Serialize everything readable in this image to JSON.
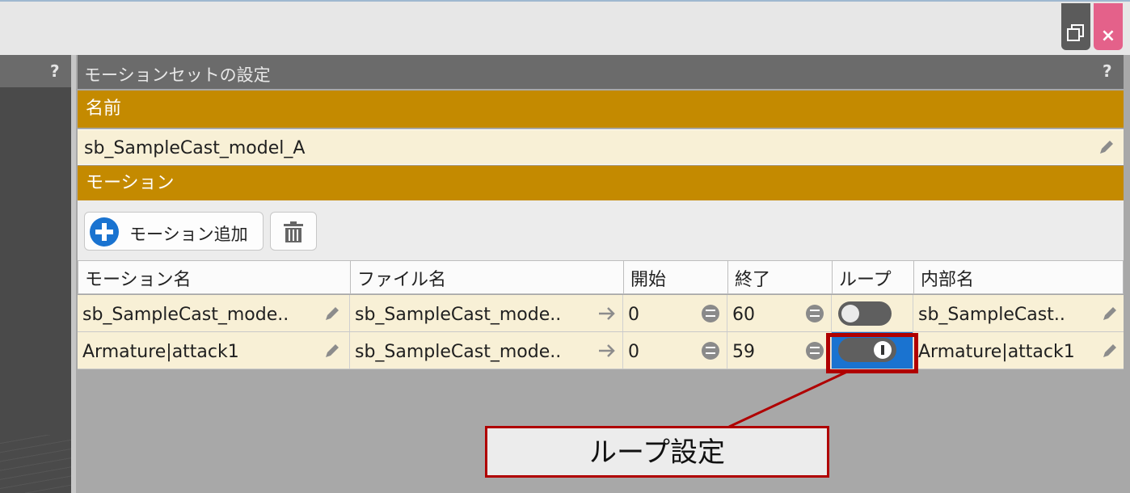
{
  "window": {
    "restore_icon": "restore-window-icon",
    "close_label": "×"
  },
  "left_panel": {
    "help_label": "?"
  },
  "panel": {
    "title": "モーションセットの設定",
    "help_label": "?"
  },
  "name_section": {
    "label": "名前",
    "value": "sb_SampleCast_model_A",
    "edit_icon": "pencil-icon"
  },
  "motion_section": {
    "label": "モーション",
    "add_button_label": "モーション追加",
    "add_icon": "plus-circle-icon",
    "delete_icon": "trash-icon"
  },
  "table": {
    "columns": [
      "モーション名",
      "ファイル名",
      "開始",
      "終了",
      "ループ",
      "内部名"
    ],
    "rows": [
      {
        "motion_name": "sb_SampleCast_mode..",
        "file_name": "sb_SampleCast_mode..",
        "start": "0",
        "end": "60",
        "loop": false,
        "internal_name": "sb_SampleCast.."
      },
      {
        "motion_name": "Armature|attack1",
        "file_name": "sb_SampleCast_mode..",
        "start": "0",
        "end": "59",
        "loop": true,
        "internal_name": "Armature|attack1"
      }
    ]
  },
  "annotation": {
    "label": "ループ設定",
    "color": "#b00000"
  },
  "colors": {
    "section_bar": "#c48a00",
    "row_bg": "#f8f0d6",
    "accent_blue": "#1a73d0",
    "close_pink": "#e4618a"
  }
}
